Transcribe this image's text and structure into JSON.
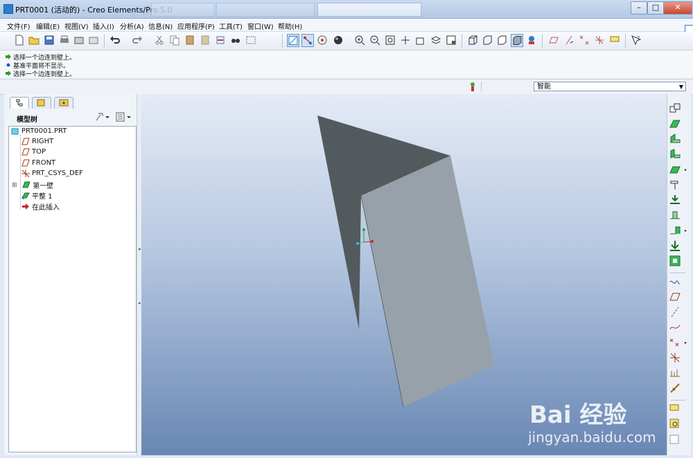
{
  "window": {
    "title": "PRT0001 (活动的) - Creo Elements/Pro 5.0",
    "controls": [
      "–",
      "□",
      "✕"
    ]
  },
  "menu": {
    "items": [
      "文件(F)",
      "编辑(E)",
      "视图(V)",
      "插入(I)",
      "分析(A)",
      "信息(N)",
      "应用程序(P)",
      "工具(T)",
      "窗口(W)",
      "帮助(H)"
    ]
  },
  "messages": [
    {
      "glyph": "arrow-right",
      "color": "#2b9a2b",
      "text": "选择一个边连到壁上。"
    },
    {
      "glyph": "dot",
      "color": "#1c5ec4",
      "text": "基准平面将不显示。"
    },
    {
      "glyph": "arrow-right",
      "color": "#2b9a2b",
      "text": "选择一个边连到壁上。"
    }
  ],
  "selection_filter": {
    "value": "智能"
  },
  "navigator": {
    "tabs": [
      "model-tree-tab",
      "layers-tab",
      "favorites-tab"
    ],
    "header": "模型树",
    "tree": [
      {
        "label": "PRT0001.PRT",
        "icon": "part-icon",
        "level": 0
      },
      {
        "label": "RIGHT",
        "icon": "datum-plane-icon",
        "level": 1
      },
      {
        "label": "TOP",
        "icon": "datum-plane-icon",
        "level": 1
      },
      {
        "label": "FRONT",
        "icon": "datum-plane-icon",
        "level": 1
      },
      {
        "label": "PRT_CSYS_DEF",
        "icon": "csys-icon",
        "level": 1
      },
      {
        "label": "第一壁",
        "icon": "sheetmetal-wall-icon",
        "level": 1,
        "expandable": true
      },
      {
        "label": "平整 1",
        "icon": "flat-wall-icon",
        "level": 1
      },
      {
        "label": "在此插入",
        "icon": "insert-here-arrow-icon",
        "level": 1
      }
    ]
  },
  "watermark": {
    "brand": "Bai 经验",
    "url": "jingyan.baidu.com"
  },
  "colors": {
    "wall_dark": "#535a5e",
    "wall_light": "#98a1a9",
    "graphics_top": "#e5ebf6",
    "graphics_bottom": "#6987b4"
  }
}
